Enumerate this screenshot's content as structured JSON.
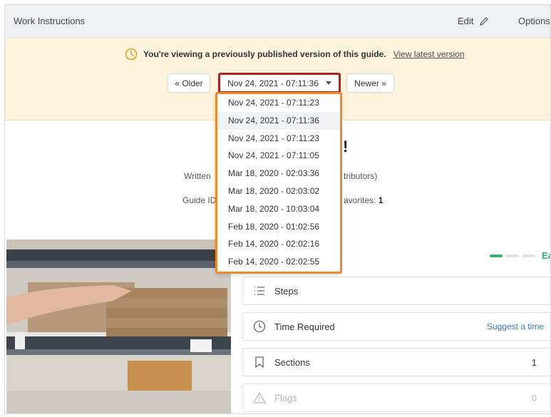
{
  "header": {
    "title": "Work Instructions",
    "edit_label": "Edit",
    "options_label": "Options"
  },
  "banner": {
    "message": "You're viewing a previously published version of this guide.",
    "link": "View latest version",
    "older_label": "« Older",
    "newer_label": "Newer »",
    "selected_version": "Nov 24, 2021 - 07:11:36"
  },
  "versions": [
    "Nov 24, 2021 - 07:11:23",
    "Nov 24, 2021 - 07:11:36",
    "Nov 24, 2021 - 07:11:23",
    "Nov 24, 2021 - 07:11:05",
    "Mar 18, 2020 - 02:03:36",
    "Mar 18, 2020 - 02:03:02",
    "Mar 18, 2020 - 10:03:04",
    "Feb 18, 2020 - 01:02:56",
    "Feb 14, 2020 - 02:02:16",
    "Feb 14, 2020 - 02:02:55"
  ],
  "guide": {
    "title_fragment": "!",
    "written_by_fragment": "Written",
    "contributors_fragment": "tributors)",
    "guide_id_fragment": "Guide ID",
    "favorites_label": "avorites: ",
    "favorites_value": "1"
  },
  "difficulty": {
    "label": "Ea",
    "level": 1,
    "of": 3,
    "color": "#2fb36a"
  },
  "details": {
    "steps_label": "Steps",
    "time_label": "Time Required",
    "time_link": "Suggest a time",
    "sections_label": "Sections",
    "sections_value": "1",
    "flags_label": "Flags",
    "flags_value": "0"
  },
  "icons": {
    "clock": "clock-icon",
    "pencil": "pencil-icon",
    "list": "list-icon",
    "bookmark": "bookmark-icon",
    "warning": "warning-icon"
  },
  "colors": {
    "highlight_box": "#a8241c",
    "dropdown_box": "#ee8a2e",
    "banner_bg": "#fdf2dc",
    "link": "#3b7bbf"
  }
}
